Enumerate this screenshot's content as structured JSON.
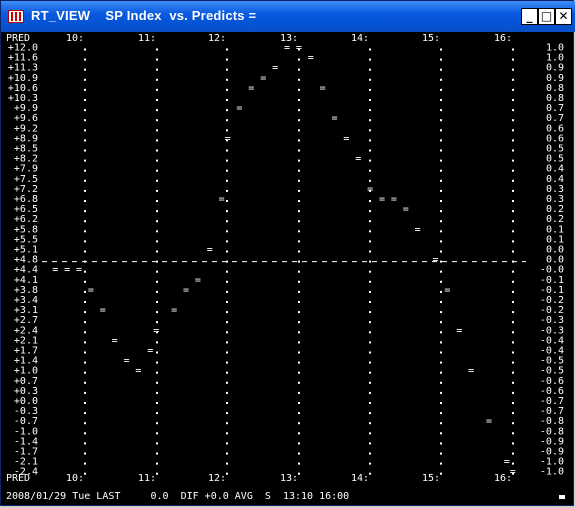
{
  "window": {
    "title": "RT_VIEW    SP Index  vs. Predicts =",
    "icon": "app-chart-icon",
    "minimize_label": "_",
    "maximize_label": "□",
    "close_label": "✕"
  },
  "chart_labels": {
    "corner_top": "PRED",
    "corner_bottom": "PRED",
    "time_top": [
      "10:",
      "11:",
      "12:",
      "13:",
      "14:",
      "15:",
      "16:"
    ],
    "time_bottom": [
      "10:",
      "11:",
      "12:",
      "13:",
      "14:",
      "15:",
      "16:"
    ]
  },
  "status_bar": {
    "text": "2008/01/29 Tue LAST     0.0  DIF +0.0 AVG  S  13:10 16:00"
  },
  "chart_data": {
    "type": "scatter",
    "title": "SP Index  vs. Predicts =",
    "marker": "=",
    "left_axis_labels": [
      "+12.0",
      "+11.6",
      "+11.3",
      "+10.9",
      "+10.6",
      "+10.3",
      "+9.9",
      "+9.6",
      "+9.2",
      "+8.9",
      "+8.5",
      "+8.2",
      "+7.9",
      "+7.5",
      "+7.2",
      "+6.8",
      "+6.5",
      "+6.2",
      "+5.8",
      "+5.5",
      "+5.1",
      "+4.8",
      "+4.4",
      "+4.1",
      "+3.8",
      "+3.4",
      "+3.1",
      "+2.7",
      "+2.4",
      "+2.1",
      "+1.7",
      "+1.4",
      "+1.0",
      "+0.7",
      "+0.3",
      "+0.0",
      "-0.3",
      "-0.7",
      "-1.0",
      "-1.4",
      "-1.7",
      "-2.1",
      "-2.4"
    ],
    "right_axis_labels": [
      "1.0",
      "1.0",
      "0.9",
      "0.9",
      "0.8",
      "0.8",
      "0.7",
      "0.7",
      "0.6",
      "0.6",
      "0.5",
      "0.5",
      "0.4",
      "0.4",
      "0.3",
      "0.3",
      "0.2",
      "0.2",
      "0.1",
      "0.1",
      "0.0",
      "0.0",
      "-0.0",
      "-0.1",
      "-0.1",
      "-0.2",
      "-0.2",
      "-0.3",
      "-0.3",
      "-0.4",
      "-0.4",
      "-0.5",
      "-0.5",
      "-0.6",
      "-0.6",
      "-0.7",
      "-0.7",
      "-0.8",
      "-0.8",
      "-0.9",
      "-0.9",
      "-1.0",
      "-1.0"
    ],
    "x_labels": [
      "10:",
      "11:",
      "12:",
      "13:",
      "14:",
      "15:",
      "16:"
    ],
    "reference_line_row": "+4.8",
    "points": [
      {
        "x": "9:40",
        "row": "+4.4"
      },
      {
        "x": "9:50",
        "row": "+4.4"
      },
      {
        "x": "10:00",
        "row": "+4.4"
      },
      {
        "x": "10:10",
        "row": "+3.8"
      },
      {
        "x": "10:20",
        "row": "+3.1"
      },
      {
        "x": "10:30",
        "row": "+2.1"
      },
      {
        "x": "10:40",
        "row": "+1.4"
      },
      {
        "x": "10:50",
        "row": "+1.0"
      },
      {
        "x": "11:00",
        "row": "+1.7"
      },
      {
        "x": "11:05",
        "row": "+2.4"
      },
      {
        "x": "11:20",
        "row": "+3.1"
      },
      {
        "x": "11:30",
        "row": "+3.8"
      },
      {
        "x": "11:40",
        "row": "+4.1"
      },
      {
        "x": "11:50",
        "row": "+5.1"
      },
      {
        "x": "12:00",
        "row": "+6.8"
      },
      {
        "x": "12:05",
        "row": "+8.9"
      },
      {
        "x": "12:15",
        "row": "+9.9"
      },
      {
        "x": "12:25",
        "row": "+10.6"
      },
      {
        "x": "12:35",
        "row": "+10.9"
      },
      {
        "x": "12:45",
        "row": "+11.3"
      },
      {
        "x": "12:55",
        "row": "+12.0"
      },
      {
        "x": "13:05",
        "row": "+12.0"
      },
      {
        "x": "13:15",
        "row": "+11.6"
      },
      {
        "x": "13:25",
        "row": "+10.6"
      },
      {
        "x": "13:35",
        "row": "+9.6"
      },
      {
        "x": "13:45",
        "row": "+8.9"
      },
      {
        "x": "13:55",
        "row": "+8.2"
      },
      {
        "x": "14:05",
        "row": "+7.2"
      },
      {
        "x": "14:15",
        "row": "+6.8"
      },
      {
        "x": "14:25",
        "row": "+6.8"
      },
      {
        "x": "14:35",
        "row": "+6.5"
      },
      {
        "x": "14:45",
        "row": "+5.8"
      },
      {
        "x": "15:00",
        "row": "+4.8"
      },
      {
        "x": "15:10",
        "row": "+3.8"
      },
      {
        "x": "15:20",
        "row": "+2.4"
      },
      {
        "x": "15:30",
        "row": "+1.0"
      },
      {
        "x": "15:45",
        "row": "-0.7"
      },
      {
        "x": "16:00",
        "row": "-2.1"
      },
      {
        "x": "16:05",
        "row": "-2.4"
      }
    ]
  }
}
